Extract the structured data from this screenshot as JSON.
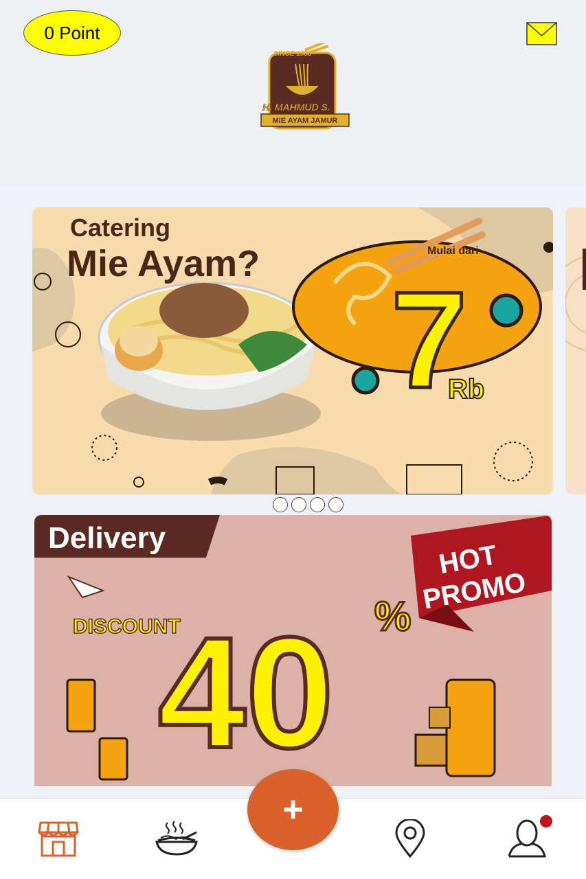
{
  "header": {
    "points_label": "0 Point",
    "mail_icon": "mail-icon"
  },
  "logo": {
    "since": "SINCE 1988",
    "brand_name": "H. MAHMUD S.",
    "tagline": "MIE AYAM JAMUR"
  },
  "carousel": {
    "slide_count": 4,
    "active_index": 0,
    "banner": {
      "title_line1": "Catering",
      "title_line2": "Mie Ayam?",
      "price_prefix": "Mulai dari",
      "price_value": "7",
      "price_unit": "Rb"
    }
  },
  "promo": {
    "label": "Delivery",
    "hot_line1": "HOT",
    "hot_line2": "PROMO",
    "discount_label": "DISCOUNT",
    "discount_value": "40",
    "discount_unit": "%"
  },
  "bottom_nav": {
    "items": [
      {
        "icon": "store-icon",
        "active": true
      },
      {
        "icon": "noodle-bowl-icon",
        "active": false
      },
      {
        "icon": "plus-icon",
        "active": false
      },
      {
        "icon": "location-pin-icon",
        "active": false
      },
      {
        "icon": "user-profile-icon",
        "active": false
      }
    ],
    "fab_label": "+"
  },
  "colors": {
    "accent": "#d9622b",
    "points_badge": "#ffff00",
    "notification": "#c0121b",
    "banner_bg": "#f9dcae",
    "promo_bg": "#dcb2a8",
    "brand_brown": "#5a2a22"
  }
}
